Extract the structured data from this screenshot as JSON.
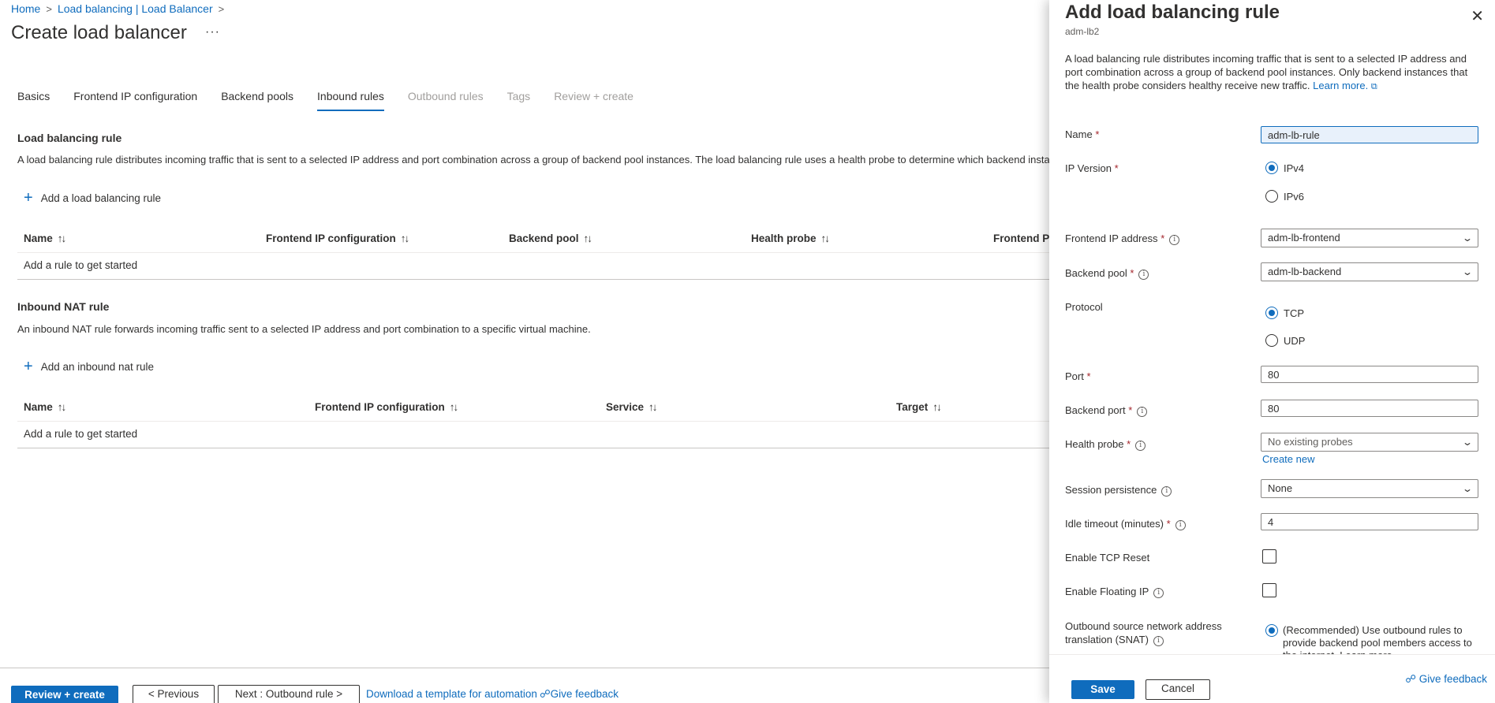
{
  "breadcrumb": {
    "items": [
      "Home",
      "Load balancing | Load Balancer"
    ]
  },
  "page": {
    "title": "Create load balancer",
    "more": "···"
  },
  "tabs": [
    {
      "label": "Basics",
      "state": "normal"
    },
    {
      "label": "Frontend IP configuration",
      "state": "normal"
    },
    {
      "label": "Backend pools",
      "state": "normal"
    },
    {
      "label": "Inbound rules",
      "state": "active"
    },
    {
      "label": "Outbound rules",
      "state": "disabled"
    },
    {
      "label": "Tags",
      "state": "disabled"
    },
    {
      "label": "Review + create",
      "state": "disabled"
    }
  ],
  "lb_section": {
    "title": "Load balancing rule",
    "description": "A load balancing rule distributes incoming traffic that is sent to a selected IP address and port combination across a group of backend pool instances. The load balancing rule uses a health probe to determine which backend insta",
    "add_label": "Add a load balancing rule",
    "columns": [
      "Name",
      "Frontend IP configuration",
      "Backend pool",
      "Health probe",
      "Frontend Po"
    ],
    "empty": "Add a rule to get started"
  },
  "nat_section": {
    "title": "Inbound NAT rule",
    "description": "An inbound NAT rule forwards incoming traffic sent to a selected IP address and port combination to a specific virtual machine.",
    "add_label": "Add an inbound nat rule",
    "columns": [
      "Name",
      "Frontend IP configuration",
      "Service",
      "Target"
    ],
    "empty": "Add a rule to get started"
  },
  "icons": {
    "sort": "↑↓",
    "plus": "+",
    "close": "✕",
    "chevron": "⌄",
    "info": "i",
    "external": "⧉",
    "feedback": "☍"
  },
  "bottom": {
    "review_create": "Review + create",
    "previous": "< Previous",
    "next": "Next : Outbound rule >",
    "download": "Download a template for automation",
    "feedback": "Give feedback"
  },
  "panel": {
    "title": "Add load balancing rule",
    "subtitle": "adm-lb2",
    "description": "A load balancing rule distributes incoming traffic that is sent to a selected IP address and port combination across a group of backend pool instances. Only backend instances that the health probe considers healthy receive new traffic.",
    "learn_more": "Learn more.",
    "fields": {
      "name": {
        "label": "Name",
        "value": "adm-lb-rule"
      },
      "ip_version": {
        "label": "IP Version",
        "options": [
          "IPv4",
          "IPv6"
        ],
        "selected": "IPv4"
      },
      "frontend_ip": {
        "label": "Frontend IP address",
        "value": "adm-lb-frontend"
      },
      "backend_pool": {
        "label": "Backend pool",
        "value": "adm-lb-backend"
      },
      "protocol": {
        "label": "Protocol",
        "options": [
          "TCP",
          "UDP"
        ],
        "selected": "TCP"
      },
      "port": {
        "label": "Port",
        "value": "80"
      },
      "backend_port": {
        "label": "Backend port",
        "value": "80"
      },
      "health_probe": {
        "label": "Health probe",
        "value": "No existing probes",
        "create_new": "Create new"
      },
      "session_persistence": {
        "label": "Session persistence",
        "value": "None"
      },
      "idle_timeout": {
        "label": "Idle timeout (minutes)",
        "value": "4"
      },
      "tcp_reset": {
        "label": "Enable TCP Reset"
      },
      "floating_ip": {
        "label": "Enable Floating IP"
      },
      "snat": {
        "label_line1": "Outbound source network address",
        "label_line2": "translation (SNAT)",
        "recommended": "(Recommended) Use outbound rules to provide backend pool members access to the internet. Learn more"
      }
    },
    "save": "Save",
    "cancel": "Cancel",
    "feedback": "Give feedback"
  },
  "colors": {
    "accent": "#0f6cbd",
    "required": "#a4262c",
    "text": "#323130",
    "disabled": "#a19f9d"
  }
}
